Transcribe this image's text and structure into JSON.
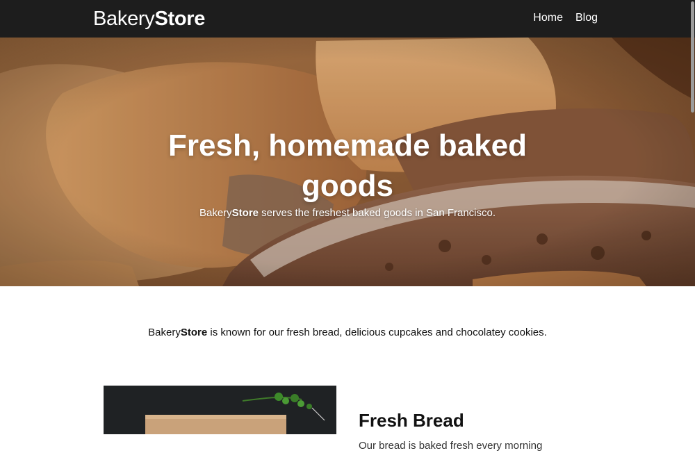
{
  "navbar": {
    "brand_light": "Bakery",
    "brand_bold": "Store",
    "links": [
      {
        "label": "Home"
      },
      {
        "label": "Blog"
      }
    ]
  },
  "hero": {
    "title_line1": "Fresh, homemade baked",
    "title_line2": "goods",
    "subtitle_brand_light": "Bakery",
    "subtitle_brand_bold": "Store",
    "subtitle_rest": " serves the freshest baked goods in San Francisco."
  },
  "intro": {
    "brand_light": "Bakery",
    "brand_bold": "Store",
    "text": " is known for our fresh bread, delicious cupcakes and chocolatey cookies."
  },
  "feature": {
    "title": "Fresh Bread",
    "text": "Our bread is baked fresh every morning"
  },
  "colors": {
    "navbar_bg": "#1d1d1d",
    "hero_bread": "#8a5a34",
    "page_bg": "#ffffff"
  }
}
